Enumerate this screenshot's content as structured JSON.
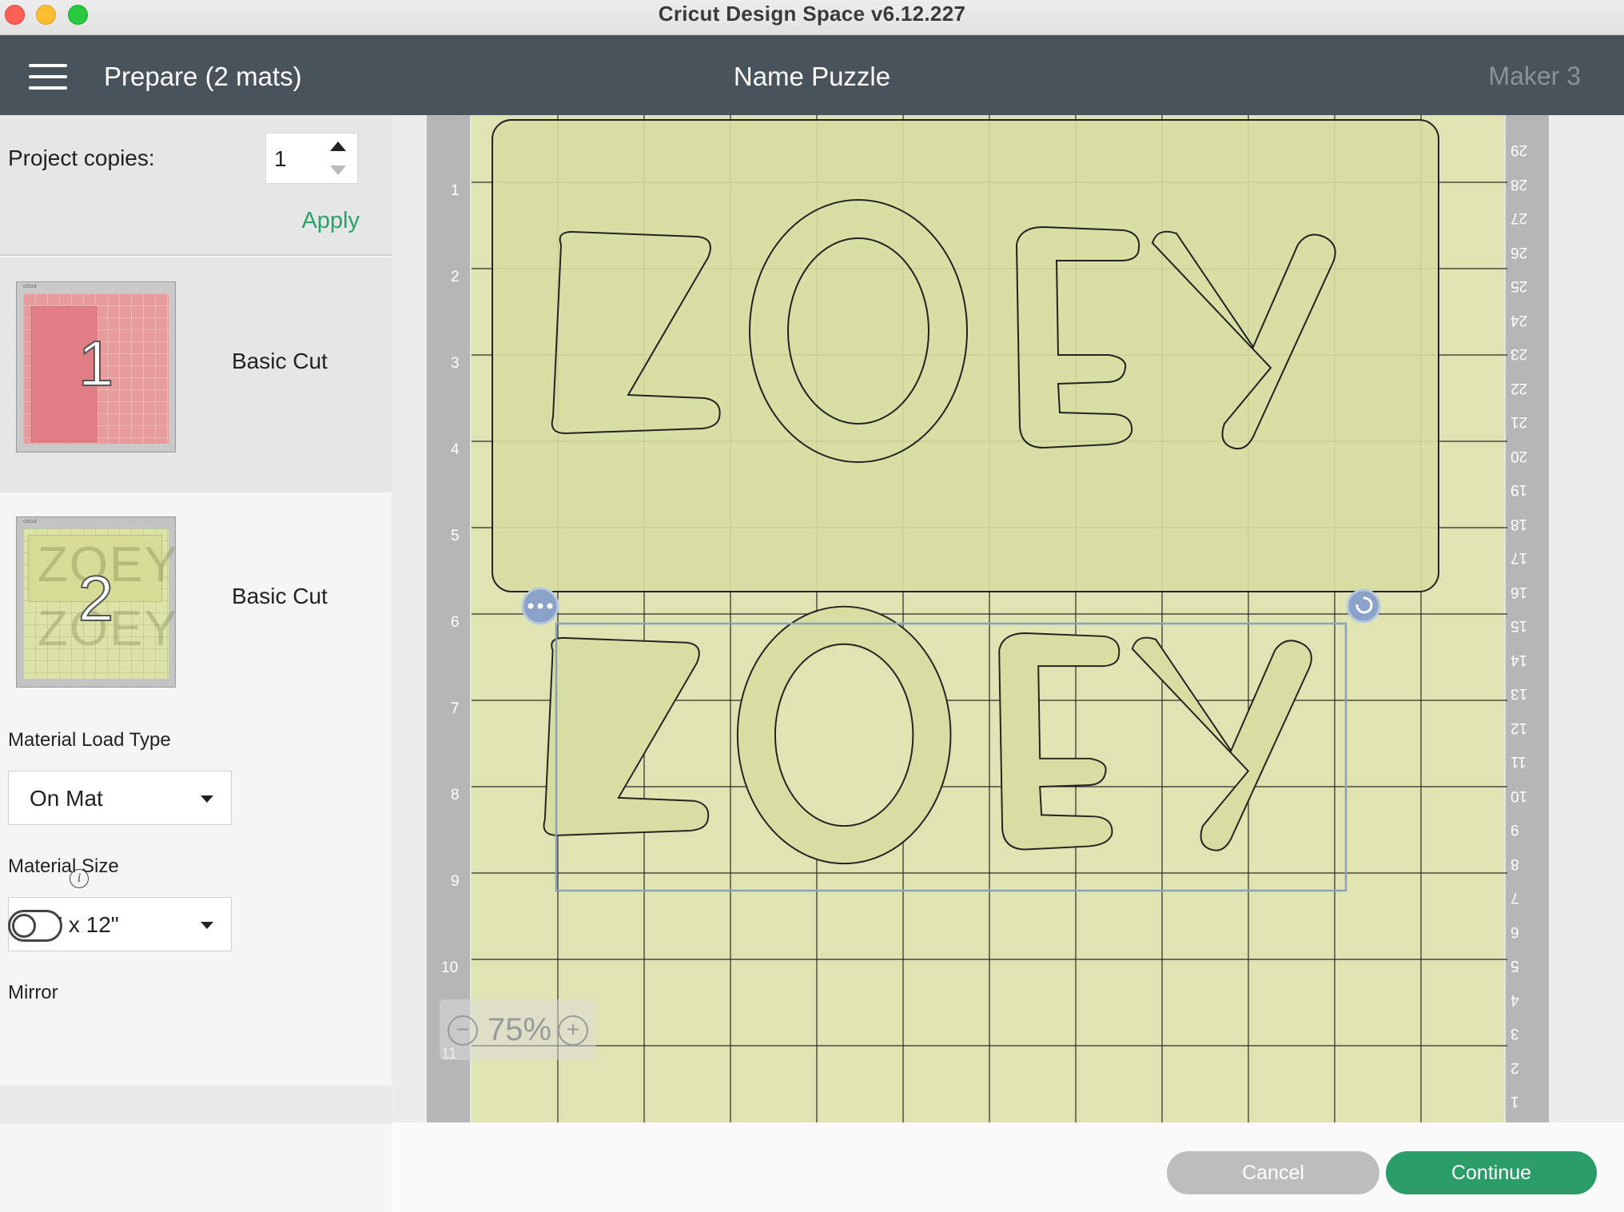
{
  "window": {
    "title": "Cricut Design Space  v6.12.227"
  },
  "header": {
    "prepare_label": "Prepare (2 mats)",
    "project_name": "Name Puzzle",
    "machine": "Maker 3"
  },
  "sidebar": {
    "copies_label": "Project copies:",
    "copies_value": "1",
    "apply_label": "Apply",
    "mats": [
      {
        "number": "1",
        "label": "Basic Cut",
        "color": "#e79b9b"
      },
      {
        "number": "2",
        "label": "Basic Cut",
        "color": "#dde3a7",
        "ghost_text": "ZOEY"
      }
    ],
    "material_load_label": "Material Load Type",
    "material_load_value": "On Mat",
    "material_size_label": "Material Size",
    "material_size_value": "12\" x 12\"",
    "mirror_label": "Mirror",
    "mirror_on": false,
    "thumb_logo": "cricut"
  },
  "canvas": {
    "left_ruler": [
      "1",
      "2",
      "3",
      "4",
      "5",
      "6",
      "7",
      "8",
      "9",
      "10",
      "11"
    ],
    "right_ruler": [
      "29",
      "28",
      "27",
      "26",
      "25",
      "24",
      "23",
      "22",
      "21",
      "20",
      "19",
      "18",
      "17",
      "16",
      "15",
      "14",
      "13",
      "12",
      "11",
      "10",
      "9",
      "8",
      "7",
      "6",
      "5",
      "4",
      "3",
      "2",
      "1"
    ],
    "zoom": "75%",
    "mat_color": "#dfe4b2",
    "shape_color": "#d6dea2",
    "selection_color": "#8aa2b8"
  },
  "footer": {
    "cancel_label": "Cancel",
    "continue_label": "Continue",
    "continue_color": "#2a9d69"
  }
}
